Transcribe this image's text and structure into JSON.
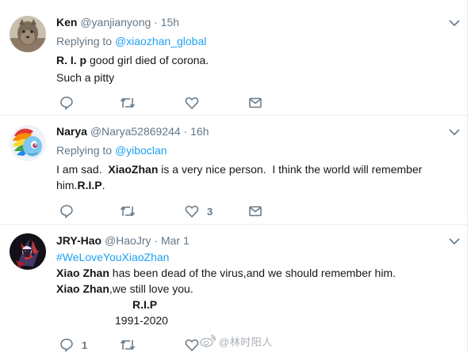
{
  "tweets": [
    {
      "name": "Ken",
      "handle": "@yanjianyong",
      "dot": "·",
      "time": "15h",
      "replying_prefix": "Replying to ",
      "replying_to": "@xiaozhan_global",
      "line1_bold": "R. I. p",
      "line1_rest": " good girl died of corona.",
      "line2": "Such a pitty"
    },
    {
      "name": "Narya",
      "handle": "@Narya52869244",
      "dot": "·",
      "time": "16h",
      "replying_prefix": "Replying to ",
      "replying_to": "@yiboclan",
      "text_pre": "I am sad.  ",
      "text_bold1": "XiaoZhan",
      "text_mid": " is a very nice person.  I think the world will remember him.",
      "text_bold2": "R.I.P",
      "text_end": ".",
      "like_count": "3"
    },
    {
      "name": "JRY-Hao",
      "handle": "@HaoJry",
      "dot": "·",
      "time": "Mar 1",
      "hashtag": "#WeLoveYouXiaoZhan",
      "line2_bold": "Xiao Zhan",
      "line2_rest": " has been dead of the virus,and we should remember him.",
      "line3_bold": "Xiao Zhan",
      "line3_rest": ",we still love you.",
      "rip": "R.I.P",
      "years": "1991-2020",
      "reply_count": "1"
    }
  ],
  "watermark": "@林时阳人",
  "colors": {
    "accent": "#1da1f2",
    "text": "#14171a",
    "muted": "#657786",
    "divider": "#e6ecf0"
  },
  "icons": [
    "reply-icon",
    "retweet-icon",
    "like-icon",
    "share-icon",
    "chevron-down-icon",
    "weibo-icon"
  ]
}
